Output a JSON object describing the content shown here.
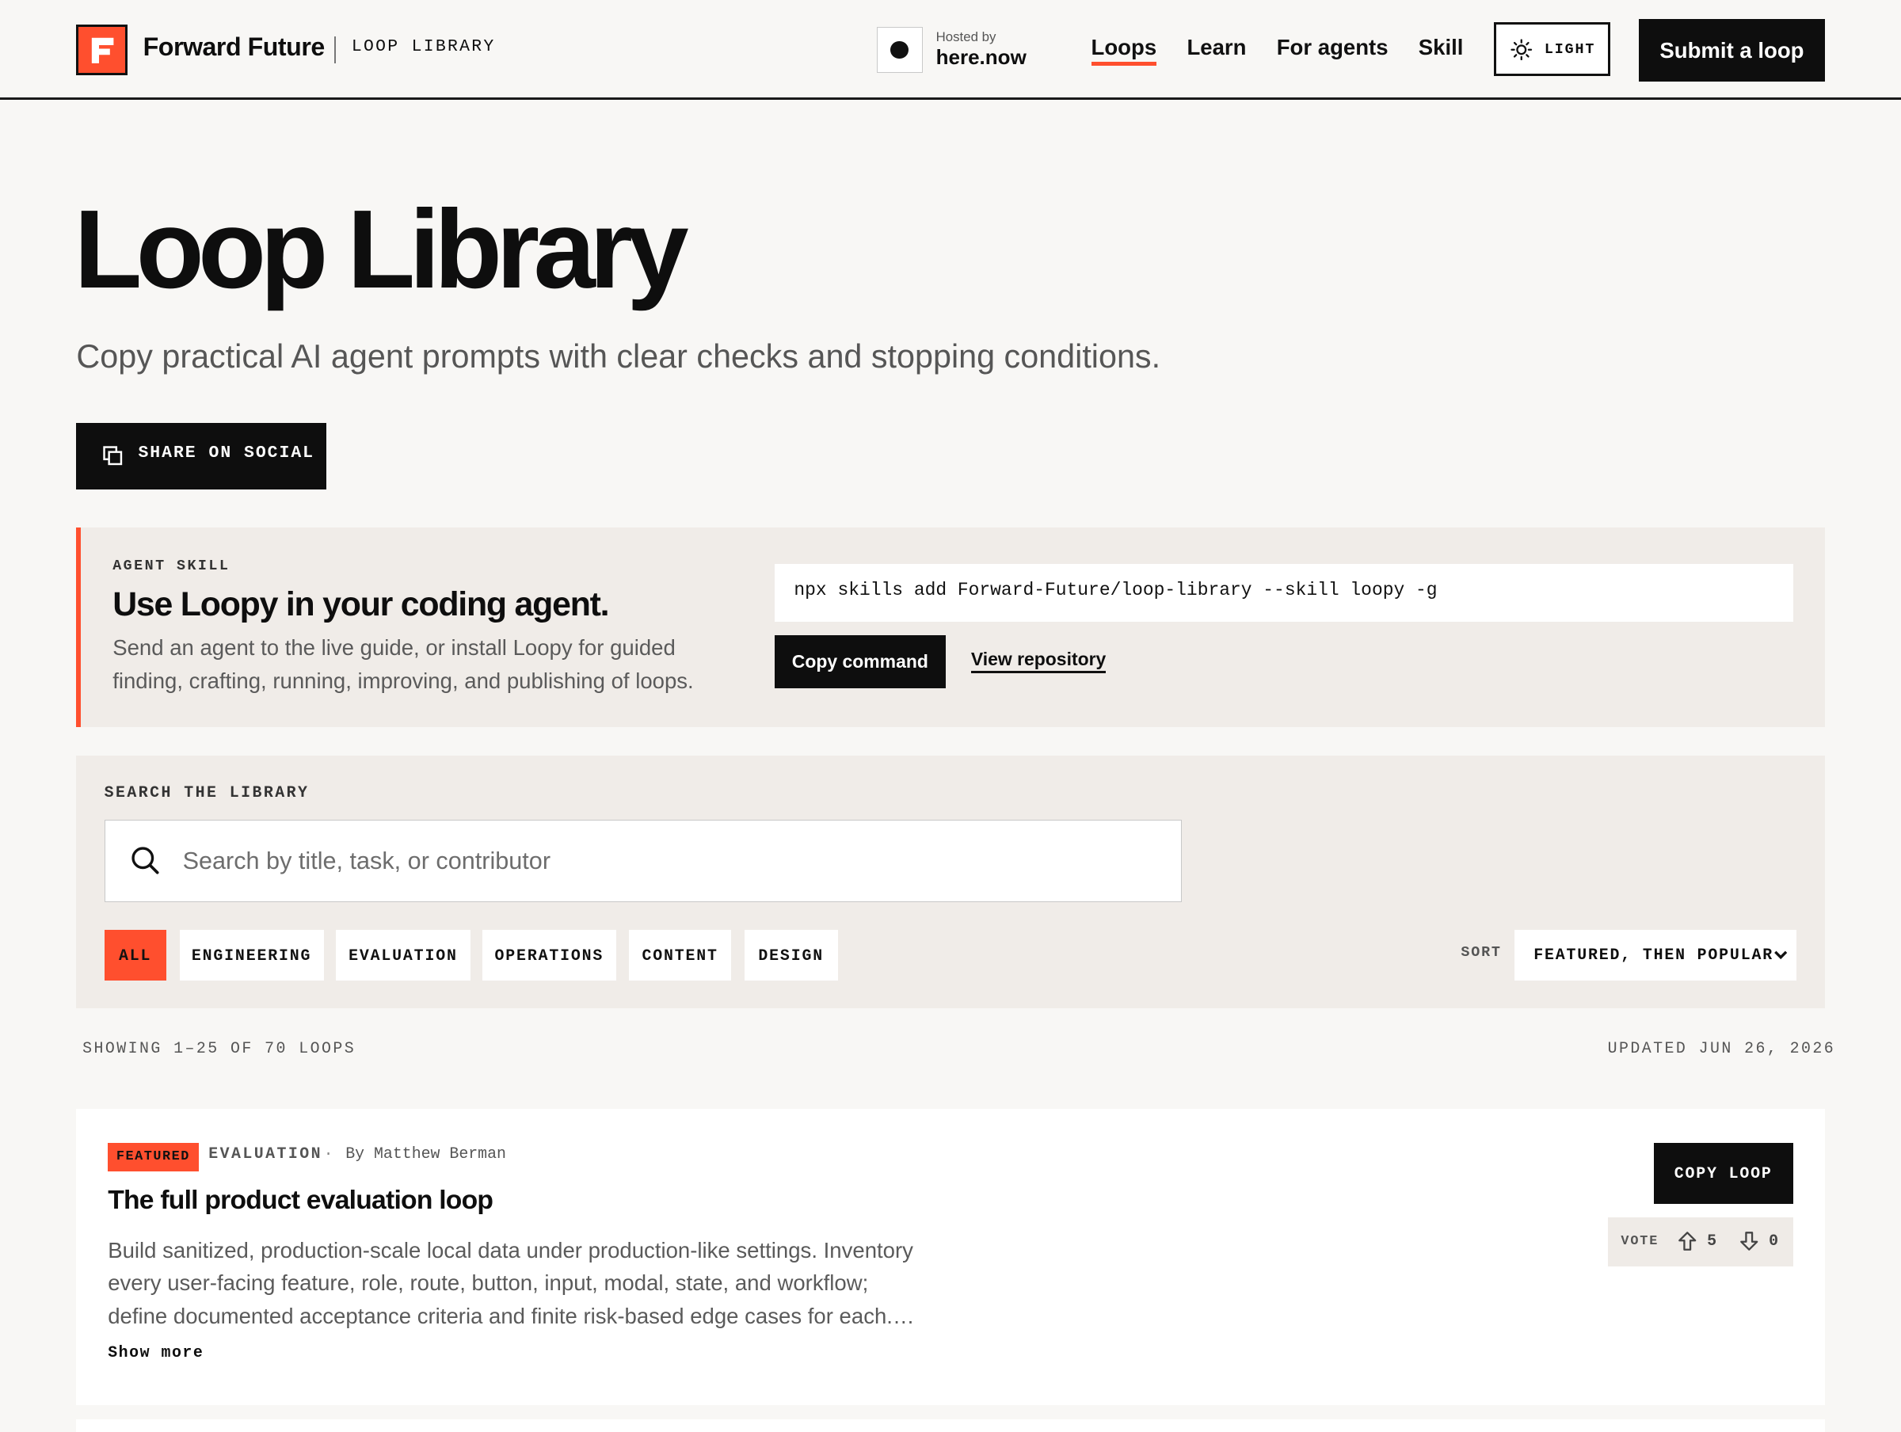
{
  "header": {
    "brand": "Forward Future",
    "section": "LOOP LIBRARY",
    "hosted_by_label": "Hosted by",
    "hosted_by_name": "here.now",
    "nav": [
      {
        "label": "Loops",
        "active": true
      },
      {
        "label": "Learn"
      },
      {
        "label": "For agents"
      },
      {
        "label": "Skill"
      }
    ],
    "theme_label": "LIGHT",
    "submit_label": "Submit a loop",
    "accent_color": "#ff4f2e"
  },
  "hero": {
    "title": "Loop Library",
    "subtitle": "Copy practical AI agent prompts with clear checks and stopping conditions.",
    "share_label": "SHARE ON SOCIAL"
  },
  "agent_skill": {
    "eyebrow": "AGENT SKILL",
    "title": "Use Loopy in your coding agent.",
    "description": "Send an agent to the live guide, or install Loopy for guided finding, crafting, running, improving, and publishing of loops.",
    "command": "npx skills add Forward-Future/loop-library --skill loopy -g",
    "copy_label": "Copy command",
    "repo_label": "View repository"
  },
  "search": {
    "eyebrow": "SEARCH THE LIBRARY",
    "placeholder": "Search by title, task, or contributor",
    "value": "",
    "filters": [
      {
        "label": "ALL",
        "active": true
      },
      {
        "label": "ENGINEERING"
      },
      {
        "label": "EVALUATION"
      },
      {
        "label": "OPERATIONS"
      },
      {
        "label": "CONTENT"
      },
      {
        "label": "DESIGN"
      }
    ],
    "sort_label": "SORT",
    "sort_value": "FEATURED, THEN POPULAR"
  },
  "results": {
    "showing": "SHOWING 1–25 OF 70 LOOPS",
    "updated": "UPDATED JUN 26, 2026"
  },
  "loops": [
    {
      "badge": "FEATURED",
      "category": "EVALUATION",
      "separator": "·",
      "author": "By Matthew Berman",
      "title": "The full product evaluation loop",
      "description": "Build sanitized, production-scale local data under production-like settings. Inventory every user-facing feature, role, route, button, input, modal, state, and workflow; define documented acceptance criteria and finite risk-based edge cases for each.…",
      "show_more": "Show more",
      "copy_label": "COPY LOOP",
      "vote_label": "VOTE",
      "upvotes": "5",
      "downvotes": "0"
    }
  ]
}
